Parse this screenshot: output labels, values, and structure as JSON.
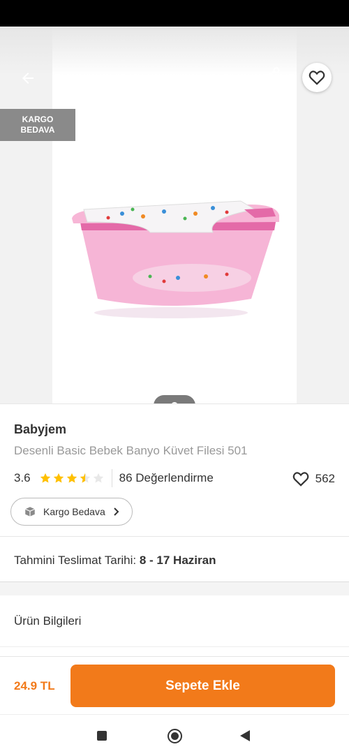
{
  "gallery": {
    "badge_line1": "KARGO",
    "badge_line2": "BEDAVA",
    "image_desc": "pink-baby-bath-tub-with-net"
  },
  "product": {
    "brand": "Babyjem",
    "name": "Desenli Basic Bebek Banyo Küvet Filesi 501",
    "rating": "3.6",
    "rating_fraction": 0.72,
    "reviews": "86 Değerlendirme",
    "favorites": "562",
    "cargo_pill": "Kargo Bedava",
    "delivery_label": "Tahmini Teslimat Tarihi:",
    "delivery_value": "8 - 17 Haziran"
  },
  "sections": {
    "product_info": "Ürün Bilgileri"
  },
  "bottom": {
    "price": "24.9 TL",
    "add_to_cart": "Sepete Ekle"
  },
  "colors": {
    "accent": "#f27a1a",
    "star": "#ffc000",
    "badge": "#8a8a8a"
  },
  "icons": [
    "back-arrow-icon",
    "share-icon",
    "heart-icon",
    "box-icon",
    "chevron-right-icon",
    "star-icon"
  ]
}
